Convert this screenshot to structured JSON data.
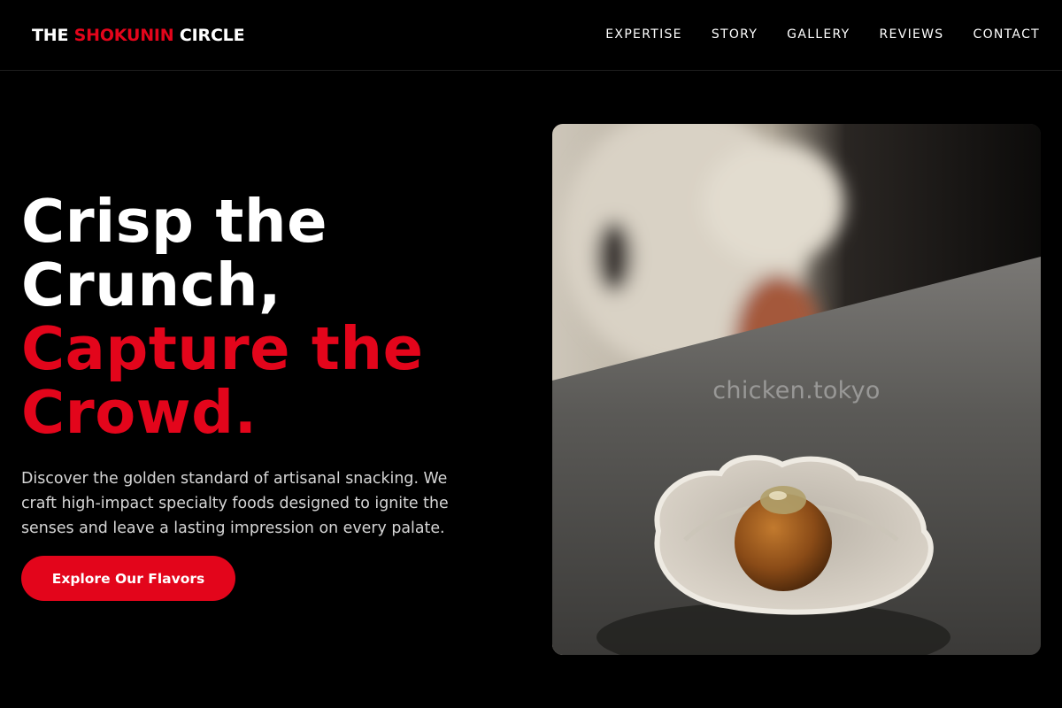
{
  "brand": {
    "prefix": "THE ",
    "accent": "SHOKUNIN",
    "suffix": " CIRCLE"
  },
  "nav": {
    "items": [
      "EXPERTISE",
      "STORY",
      "GALLERY",
      "REVIEWS",
      "CONTACT"
    ]
  },
  "hero": {
    "title_line_1": "Crisp the",
    "title_line_2": "Crunch,",
    "title_line_3": "Capture the",
    "title_line_4": "Crowd.",
    "description": "Discover the golden standard of artisanal snacking. We craft high-impact specialty foods designed to ignite the senses and leave a lasting impression on every palate.",
    "cta_label": "Explore Our Flavors"
  },
  "photo": {
    "watermark": "chicken.tokyo"
  },
  "colors": {
    "accent": "#e3051b",
    "background": "#000000",
    "text": "#ffffff"
  }
}
